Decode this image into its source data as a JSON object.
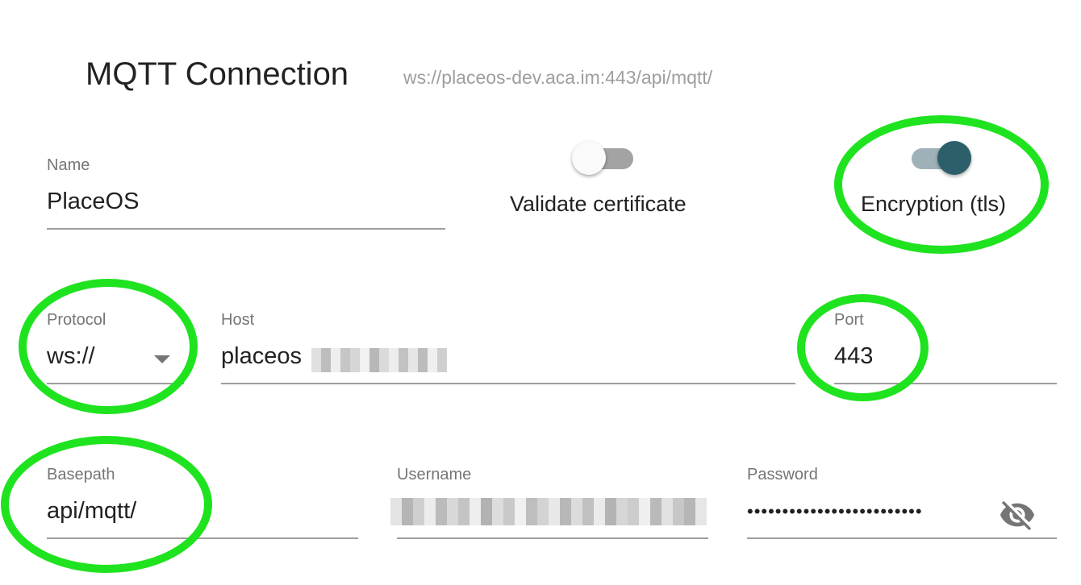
{
  "header": {
    "title": "MQTT Connection",
    "url": "ws://placeos-dev.aca.im:443/api/mqtt/"
  },
  "name_field": {
    "label": "Name",
    "value": "PlaceOS"
  },
  "validate_certificate": {
    "label": "Validate certificate",
    "checked": false
  },
  "encryption": {
    "label": "Encryption (tls)",
    "checked": true
  },
  "protocol": {
    "label": "Protocol",
    "value": "ws://"
  },
  "host": {
    "label": "Host",
    "value": "placeos"
  },
  "port": {
    "label": "Port",
    "value": "443"
  },
  "basepath": {
    "label": "Basepath",
    "value": "api/mqtt/"
  },
  "username": {
    "label": "Username"
  },
  "password": {
    "label": "Password",
    "masked": "•••••••••••••••••••••••••"
  },
  "icons": {
    "visibility_toggle": "eye-off-icon",
    "dropdown": "caret-down-icon"
  },
  "colors": {
    "accent": "#2d5f6b",
    "highlight": "#1fe31f"
  }
}
